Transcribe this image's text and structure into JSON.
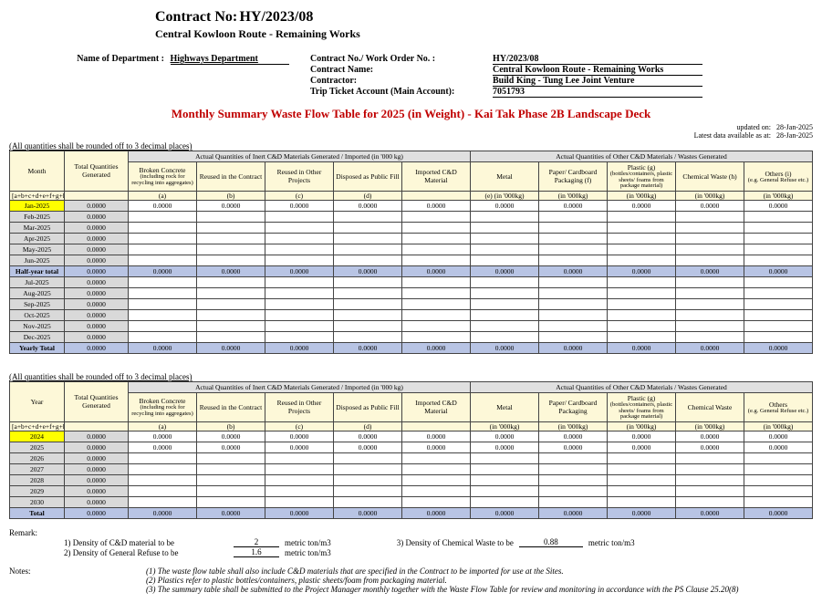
{
  "header": {
    "contract_no_label": "Contract No:",
    "contract_no": "HY/2023/08",
    "sub": "Central Kowloon Route - Remaining Works",
    "dept_label": "Name of Department :",
    "dept": "Highways Department",
    "rows": [
      {
        "label": "Contract No./ Work Order No. :",
        "value": "HY/2023/08"
      },
      {
        "label": "Contract Name:",
        "value": "Central Kowloon Route - Remaining Works"
      },
      {
        "label": "Contractor:",
        "value": "Build King - Tung Lee Joint Venture"
      },
      {
        "label": "Trip Ticket Account (Main Account):",
        "value": "7051793"
      }
    ]
  },
  "title": "Monthly Summary Waste Flow Table for 2025 (in Weight) - Kai Tak Phase 2B Landscape Deck",
  "meta": {
    "updated_label": "updated on:",
    "updated": "28-Jan-2025",
    "latest_label": "Latest data available as at:",
    "latest": "28-Jan-2025"
  },
  "rounded_note": "(All quantities shall be rounded off to 3 decimal places)",
  "table_headers": {
    "month": "Month",
    "year": "Year",
    "total_gen": "Total Quantities Generated",
    "formula": "[a+b+c+d+e+f+g+h+i]",
    "inert_group": "Actual Quantities of Inert C&D Materials Generated / Imported (in '000 kg)",
    "other_group": "Actual Quantities of Other C&D Materials / Wastes Generated",
    "a": "Broken Concrete",
    "a_sub": "(including rock for recycling into aggregates)",
    "a_tag": "(a)",
    "b": "Reused in the Contract",
    "b_tag": "(b)",
    "c": "Reused in Other Projects",
    "c_tag": "(c)",
    "d": "Disposed as Public Fill",
    "d_tag": "(d)",
    "import": "Imported C&D Material",
    "e": "Metal",
    "e_tag": "(e)  (in '000kg)",
    "f": "Paper/ Cardboard Packaging  (f)",
    "f_tag": "(in '000kg)",
    "g": "Plastic  (g)",
    "g_sub": "(bottles/containers, plastic sheets/ foams from package material)",
    "g_tag": "(in '000kg)",
    "h": "Chemical Waste (h)",
    "h_tag": "(in '000kg)",
    "i": "Others (i)",
    "i_sub": "(e.g. General Refuse etc.)",
    "i_tag": "(in '000kg)",
    "f2": "Paper/ Cardboard Packaging",
    "h2": "Chemical Waste",
    "i2": "Others",
    "g_tag2": "(in '000kg)"
  },
  "months": [
    {
      "name": "Jan-2025",
      "highlight": true,
      "gen": "0.0000",
      "vals": [
        "0.0000",
        "0.0000",
        "0.0000",
        "0.0000",
        "0.0000",
        "0.0000",
        "0.0000",
        "0.0000",
        "0.0000",
        "0.0000"
      ]
    },
    {
      "name": "Feb-2025",
      "gen": "0.0000"
    },
    {
      "name": "Mar-2025",
      "gen": "0.0000"
    },
    {
      "name": "Apr-2025",
      "gen": "0.0000"
    },
    {
      "name": "May-2025",
      "gen": "0.0000"
    },
    {
      "name": "Jun-2025",
      "gen": "0.0000"
    }
  ],
  "half_total": {
    "name": "Half-year total",
    "gen": "0.0000",
    "vals": [
      "0.0000",
      "0.0000",
      "0.0000",
      "0.0000",
      "0.0000",
      "0.0000",
      "0.0000",
      "0.0000",
      "0.0000",
      "0.0000"
    ]
  },
  "months2": [
    {
      "name": "Jul-2025",
      "gen": "0.0000"
    },
    {
      "name": "Aug-2025",
      "gen": "0.0000"
    },
    {
      "name": "Sep-2025",
      "gen": "0.0000"
    },
    {
      "name": "Oct-2025",
      "gen": "0.0000"
    },
    {
      "name": "Nov-2025",
      "gen": "0.0000"
    },
    {
      "name": "Dec-2025",
      "gen": "0.0000"
    }
  ],
  "year_total": {
    "name": "Yearly Total",
    "gen": "0.0000",
    "vals": [
      "0.0000",
      "0.0000",
      "0.0000",
      "0.0000",
      "0.0000",
      "0.0000",
      "0.0000",
      "0.0000",
      "0.0000",
      "0.0000"
    ]
  },
  "years": [
    {
      "name": "2024",
      "highlight": true,
      "gen": "0.0000",
      "vals": [
        "0.0000",
        "0.0000",
        "0.0000",
        "0.0000",
        "0.0000",
        "0.0000",
        "0.0000",
        "0.0000",
        "0.0000",
        "0.0000"
      ]
    },
    {
      "name": "2025",
      "gen": "0.0000",
      "vals": [
        "0.0000",
        "0.0000",
        "0.0000",
        "0.0000",
        "0.0000",
        "0.0000",
        "0.0000",
        "0.0000",
        "0.0000",
        "0.0000"
      ]
    },
    {
      "name": "2026",
      "gen": "0.0000"
    },
    {
      "name": "2027",
      "gen": "0.0000"
    },
    {
      "name": "2028",
      "gen": "0.0000"
    },
    {
      "name": "2029",
      "gen": "0.0000"
    },
    {
      "name": "2030",
      "gen": "0.0000"
    }
  ],
  "years_total": {
    "name": "Total",
    "gen": "0.0000",
    "vals": [
      "0.0000",
      "0.0000",
      "0.0000",
      "0.0000",
      "0.0000",
      "0.0000",
      "0.0000",
      "0.0000",
      "0.0000",
      "0.0000"
    ]
  },
  "remark": {
    "title": "Remark:",
    "r1_label": "1) Density of C&D material to be",
    "r1_val": "2",
    "unit": "metric ton/m3",
    "r2_label": "2) Density of General Refuse to be",
    "r2_val": "1.6",
    "r3_label": "3) Density of Chemical Waste to be",
    "r3_val": "0.88"
  },
  "notes": {
    "label": "Notes:",
    "items": [
      "(1)  The waste flow table shall also include C&D materials that are specified in the Contract to be imported for use at the Sites.",
      "(2)  Plastics refer to plastic bottles/containers, plastic sheets/foam from packaging material.",
      "(3)  The summary table shall be submitted to the Project Manager monthly together with the Waste Flow Table for review and monitoring in accordance with the PS Clause 25.20(8)"
    ]
  }
}
